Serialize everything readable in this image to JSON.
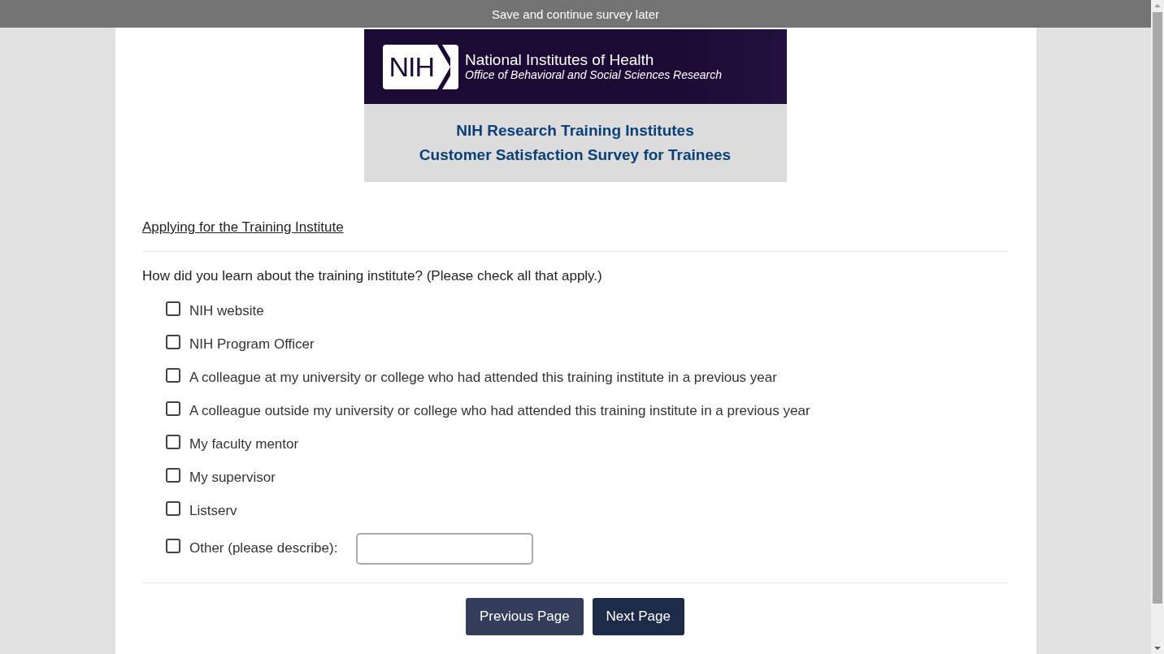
{
  "top_bar": {
    "label": "Save and continue survey later"
  },
  "banner": {
    "logo_text": "NIH",
    "org_name": "National Institutes of Health",
    "office": "Office of Behavioral and Social Sciences Research",
    "title_lines": [
      "NIH Research Training Institutes",
      "Customer Satisfaction Survey for Trainees"
    ]
  },
  "section_title": "Applying for the Training Institute",
  "question": "How did you learn about the training institute? (Please check all that apply.)",
  "options": [
    {
      "label": "NIH website",
      "checked": false,
      "kind": "checkbox"
    },
    {
      "label": "NIH Program Officer",
      "checked": false,
      "kind": "checkbox"
    },
    {
      "label": "A colleague at my university or college who had attended this training institute in a previous year",
      "checked": false,
      "kind": "checkbox"
    },
    {
      "label": "A colleague outside my university or college who had attended this training institute in a previous year",
      "checked": false,
      "kind": "checkbox"
    },
    {
      "label": "My faculty mentor",
      "checked": false,
      "kind": "checkbox"
    },
    {
      "label": "My supervisor",
      "checked": false,
      "kind": "checkbox"
    },
    {
      "label": "Listserv",
      "checked": false,
      "kind": "checkbox"
    },
    {
      "label": "Other (please describe):",
      "checked": false,
      "kind": "checkbox_text"
    }
  ],
  "buttons": [
    {
      "label": "Previous Page",
      "kind": "secondary"
    },
    {
      "label": "Next Page",
      "kind": "primary"
    }
  ]
}
